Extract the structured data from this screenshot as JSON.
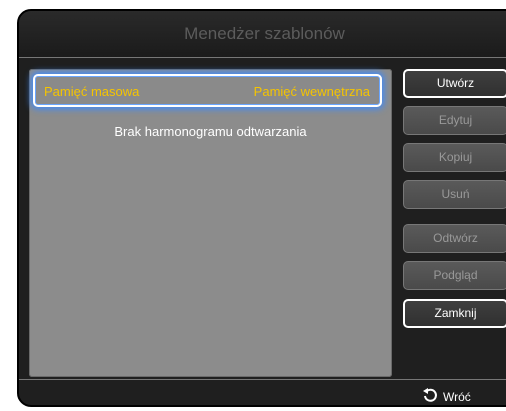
{
  "window": {
    "title": "Menedżer szablonów"
  },
  "storage": {
    "left_label": "Pamięć masowa",
    "right_label": "Pamięć wewnętrzna"
  },
  "main": {
    "empty_message": "Brak harmonogramu odtwarzania"
  },
  "buttons": {
    "create": "Utwórz",
    "edit": "Edytuj",
    "copy": "Kopiuj",
    "delete": "Usuń",
    "play": "Odtwórz",
    "preview": "Podgląd",
    "close": "Zamknij"
  },
  "footer": {
    "back_label": "Wróć",
    "back_icon": "return-arrow-icon"
  },
  "colors": {
    "accent_text": "#f5c400",
    "focus_glow": "#3d8bff"
  }
}
